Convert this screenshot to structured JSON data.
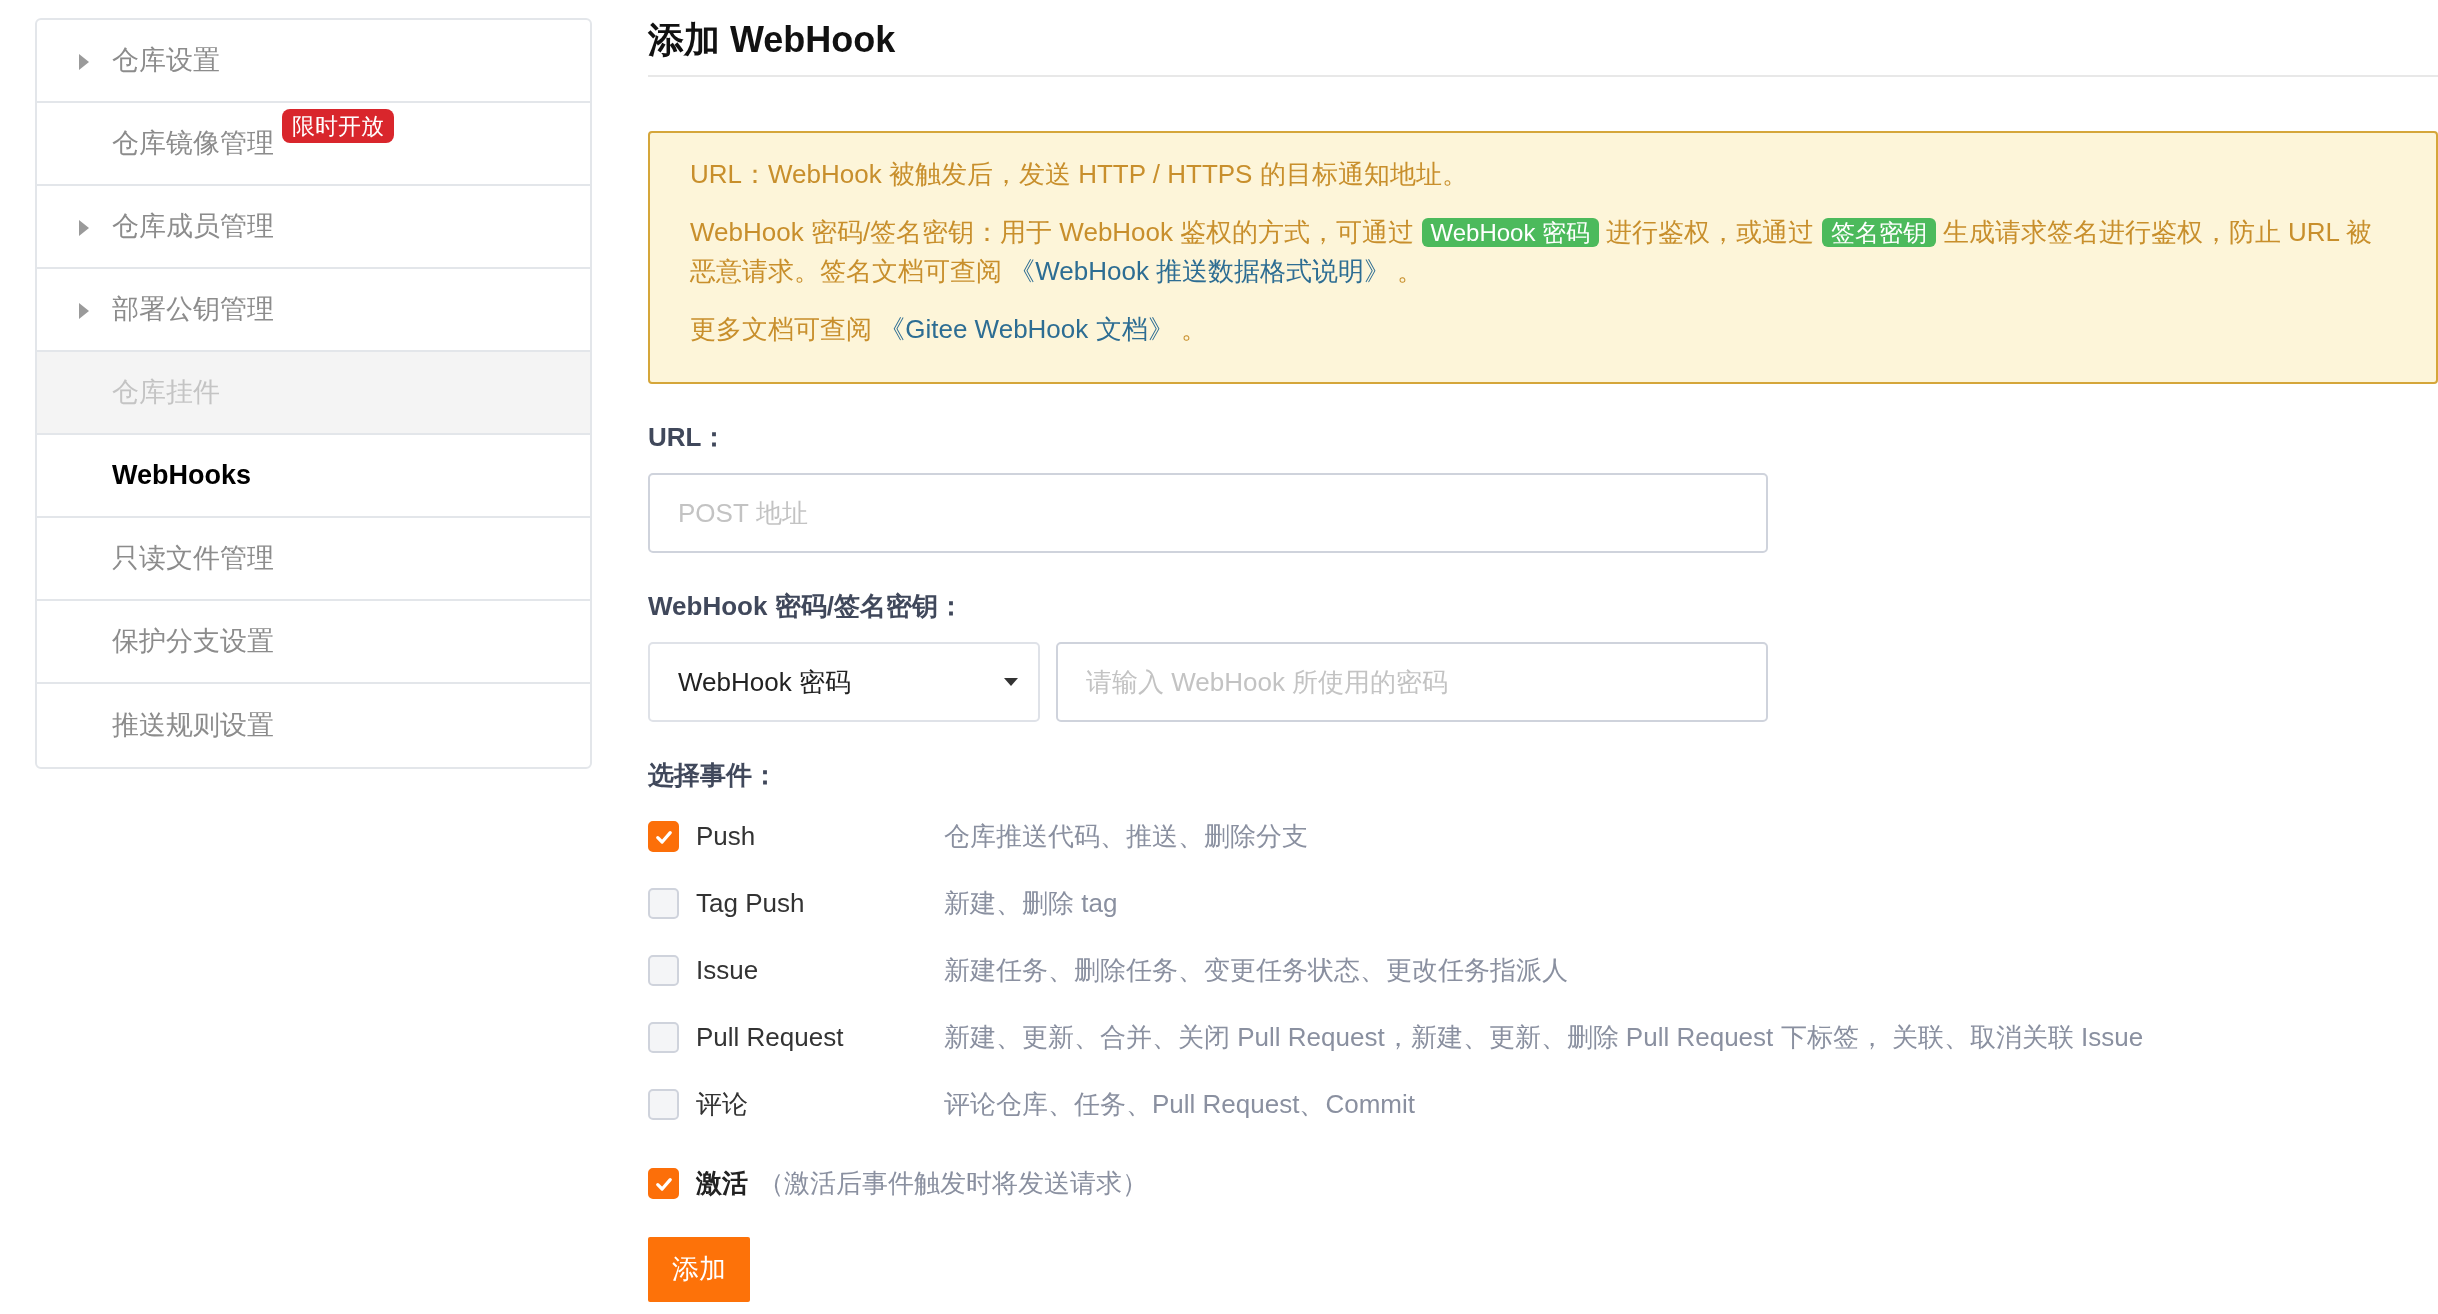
{
  "sidebar": {
    "items": [
      {
        "label": "仓库设置",
        "expandable": true,
        "disabled": false,
        "selected": false
      },
      {
        "label": "仓库镜像管理",
        "expandable": false,
        "disabled": false,
        "selected": false,
        "badge": "限时开放"
      },
      {
        "label": "仓库成员管理",
        "expandable": true,
        "disabled": false,
        "selected": false
      },
      {
        "label": "部署公钥管理",
        "expandable": true,
        "disabled": false,
        "selected": false
      },
      {
        "label": "仓库挂件",
        "expandable": false,
        "disabled": true,
        "selected": false
      },
      {
        "label": "WebHooks",
        "expandable": false,
        "disabled": false,
        "selected": true
      },
      {
        "label": "只读文件管理",
        "expandable": false,
        "disabled": false,
        "selected": false
      },
      {
        "label": "保护分支设置",
        "expandable": false,
        "disabled": false,
        "selected": false
      },
      {
        "label": "推送规则设置",
        "expandable": false,
        "disabled": false,
        "selected": false
      }
    ]
  },
  "title": "添加 WebHook",
  "notice": {
    "paragraphs": [
      [
        {
          "kind": "text",
          "text": "URL：WebHook 被触发后，发送 HTTP / HTTPS 的目标通知地址。"
        }
      ],
      [
        {
          "kind": "text",
          "text": "WebHook 密码/签名密钥：用于 WebHook 鉴权的方式，可通过 "
        },
        {
          "kind": "tag",
          "text": "WebHook 密码"
        },
        {
          "kind": "text",
          "text": " 进行鉴权，或通过 "
        },
        {
          "kind": "tag",
          "text": "签名密钥"
        },
        {
          "kind": "text",
          "text": " 生成请求签名进行鉴权，防止 URL 被恶意请求。签名文档可查阅 "
        },
        {
          "kind": "link",
          "text": "《WebHook 推送数据格式说明》"
        },
        {
          "kind": "text",
          "text": " 。"
        }
      ],
      [
        {
          "kind": "text",
          "text": "更多文档可查阅 "
        },
        {
          "kind": "link",
          "text": "《Gitee WebHook 文档》"
        },
        {
          "kind": "text",
          "text": " 。"
        }
      ]
    ]
  },
  "url": {
    "label": "URL：",
    "placeholder": "POST 地址"
  },
  "secret": {
    "label": "WebHook 密码/签名密钥：",
    "type_value": "WebHook 密码",
    "placeholder": "请输入 WebHook 所使用的密码"
  },
  "events": {
    "label": "选择事件：",
    "items": [
      {
        "label": "Push",
        "description": "仓库推送代码、推送、删除分支",
        "checked": true
      },
      {
        "label": "Tag Push",
        "description": "新建、删除 tag",
        "checked": false
      },
      {
        "label": "Issue",
        "description": "新建任务、删除任务、变更任务状态、更改任务指派人",
        "checked": false
      },
      {
        "label": "Pull Request",
        "description": "新建、更新、合并、关闭 Pull Request，新建、更新、删除 Pull Request 下标签， 关联、取消关联 Issue",
        "checked": false
      },
      {
        "label": "评论",
        "description": "评论仓库、任务、Pull Request、Commit",
        "checked": false
      }
    ]
  },
  "activate": {
    "label": "激活",
    "note": "（激活后事件触发时将发送请求）",
    "checked": true
  },
  "submit": "添加"
}
